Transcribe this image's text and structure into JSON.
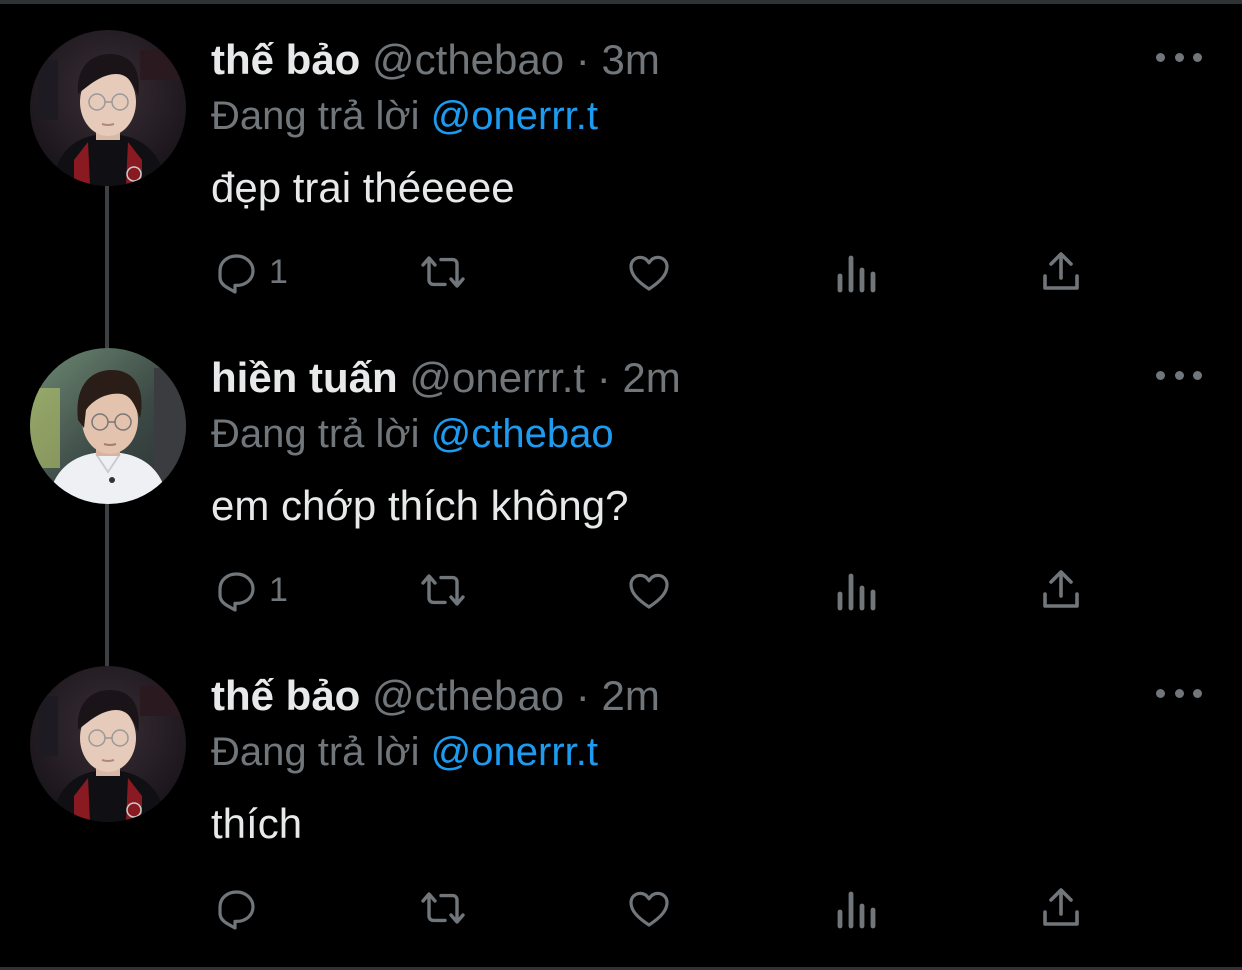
{
  "colors": {
    "background": "#000000",
    "text_primary": "#e7e9ea",
    "text_secondary": "#71767b",
    "mention": "#1d9bf0",
    "thread_line": "#3e4144"
  },
  "tweets": [
    {
      "author_name": "thế bảo",
      "handle": "@cthebao",
      "separator": "·",
      "time": "3m",
      "replying_prefix": "Đang trả lời",
      "replying_to": "@onerrr.t",
      "text": "đẹp trai théeeee",
      "reply_count": "1",
      "avatar_icon": "avatar-photo-cthebao"
    },
    {
      "author_name": "hiền tuấn",
      "handle": "@onerrr.t",
      "separator": "·",
      "time": "2m",
      "replying_prefix": "Đang trả lời",
      "replying_to": "@cthebao",
      "text": "em chớp thích không?",
      "reply_count": "1",
      "avatar_icon": "avatar-photo-onerrr"
    },
    {
      "author_name": "thế bảo",
      "handle": "@cthebao",
      "separator": "·",
      "time": "2m",
      "replying_prefix": "Đang trả lời",
      "replying_to": "@onerrr.t",
      "text": "thích",
      "reply_count": "",
      "avatar_icon": "avatar-photo-cthebao"
    }
  ],
  "action_icons": [
    "reply-icon",
    "retweet-icon",
    "like-icon",
    "views-icon",
    "share-icon"
  ]
}
